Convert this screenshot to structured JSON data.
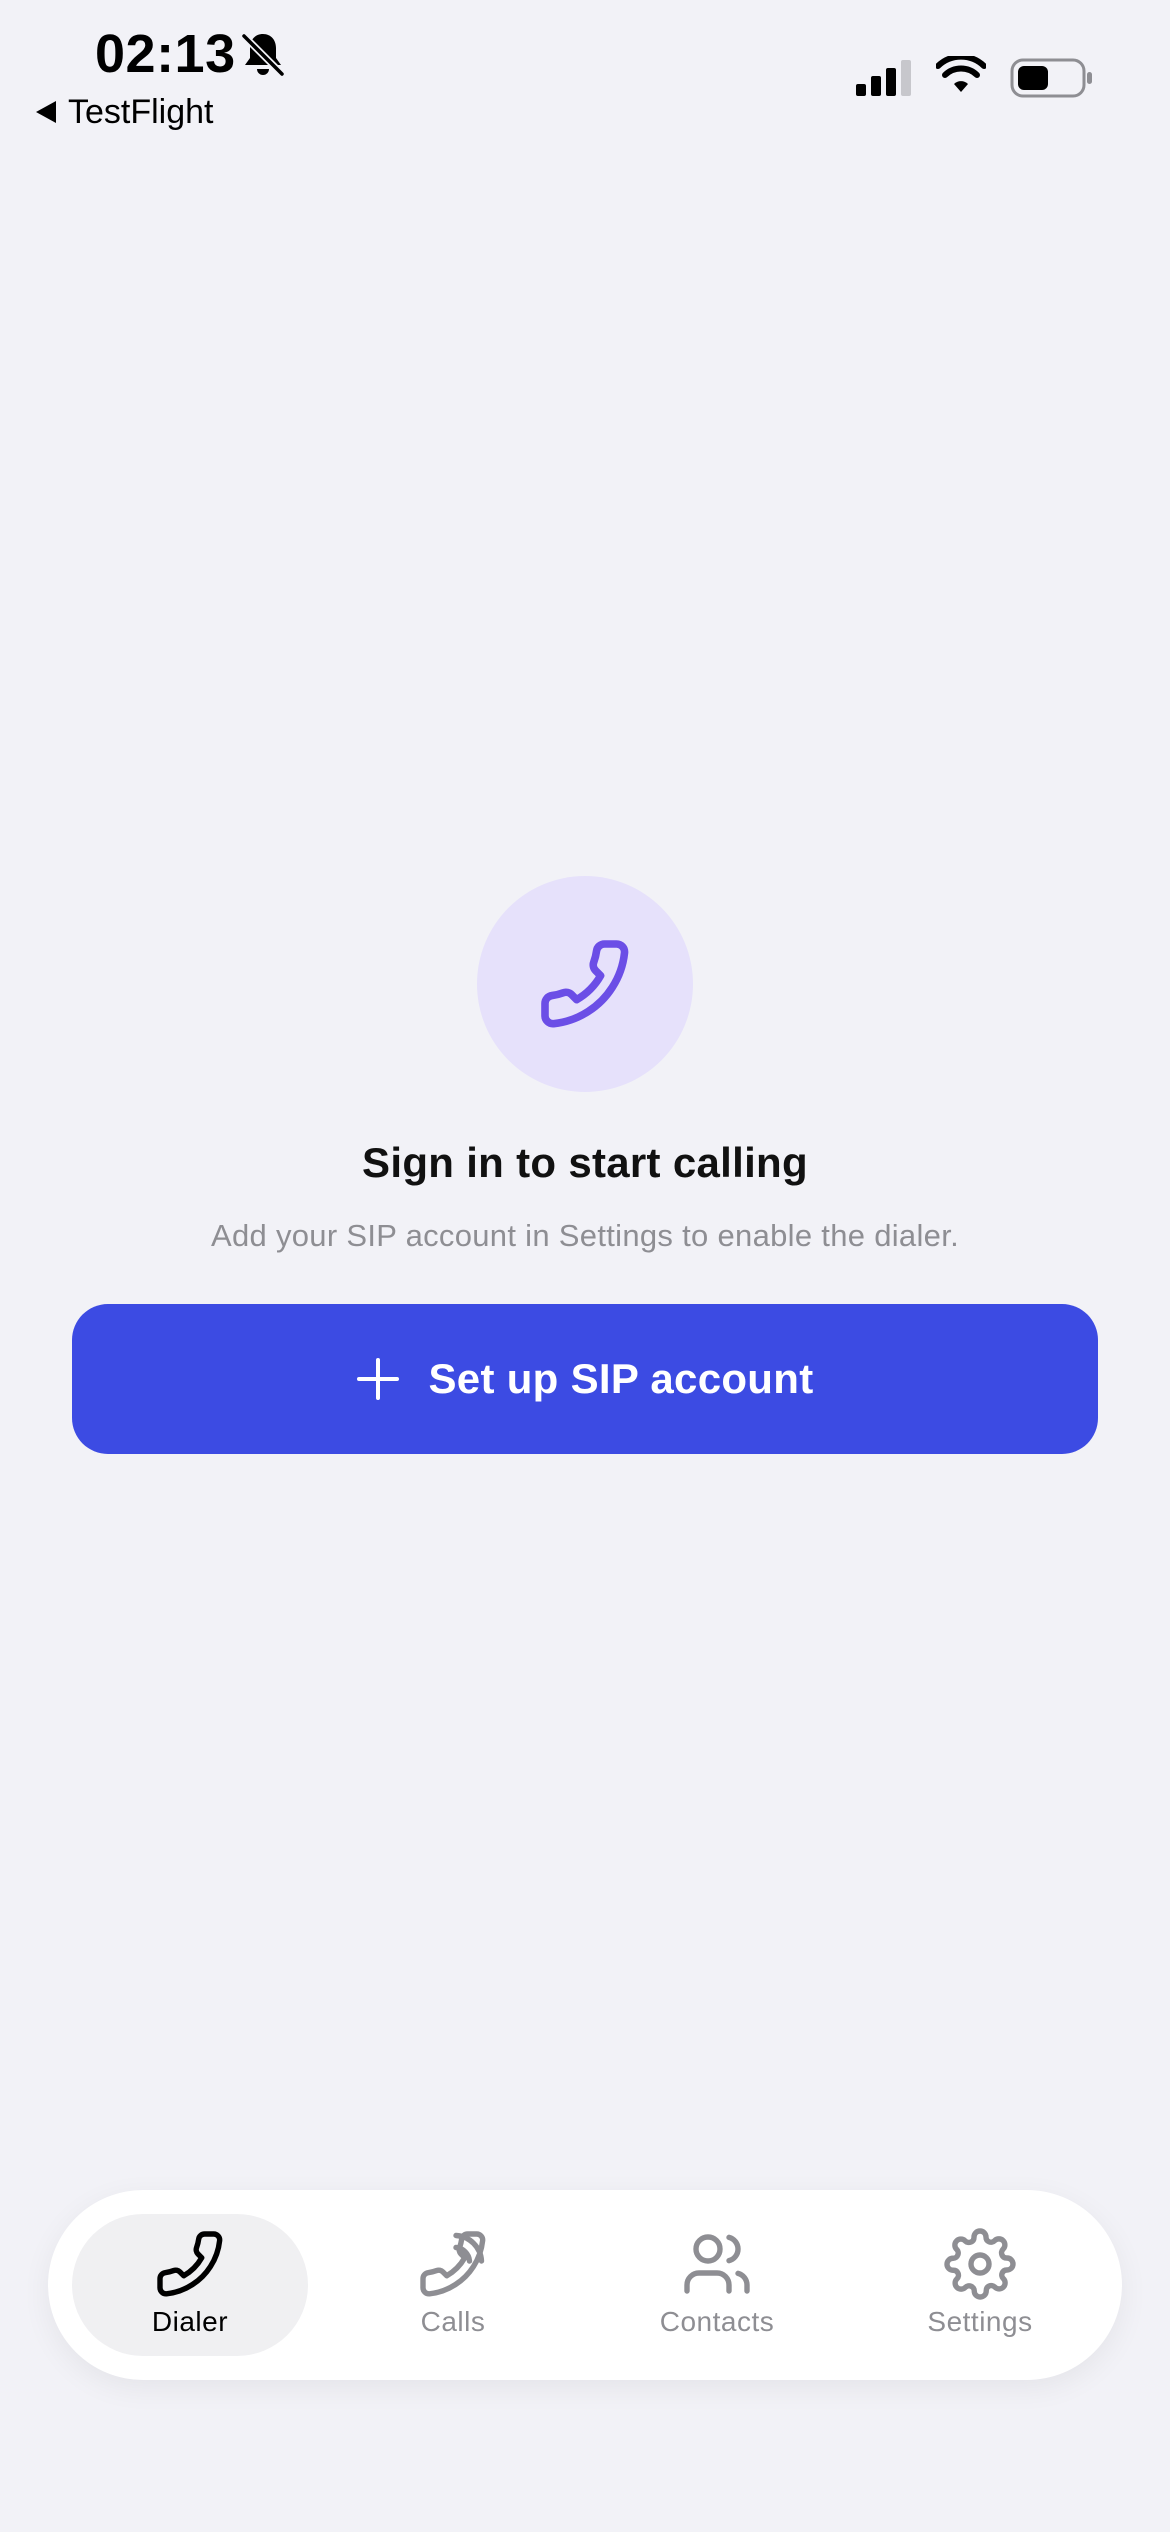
{
  "status_bar": {
    "time": "02:13",
    "back_label": "TestFlight",
    "icons": [
      "bell-slash-icon",
      "cellular-signal-icon",
      "wifi-icon",
      "battery-icon"
    ]
  },
  "empty_state": {
    "icon": "phone-icon",
    "title": "Sign in to start calling",
    "subtitle": "Add your SIP account in Settings to enable the dialer."
  },
  "setup_button": {
    "icon": "plus-icon",
    "label": "Set up SIP account"
  },
  "tab_bar": {
    "tabs": [
      {
        "label": "Dialer",
        "icon": "phone-icon",
        "active": true
      },
      {
        "label": "Calls",
        "icon": "phone-outgoing-icon",
        "active": false
      },
      {
        "label": "Contacts",
        "icon": "users-icon",
        "active": false
      },
      {
        "label": "Settings",
        "icon": "gear-icon",
        "active": false
      }
    ]
  },
  "colors": {
    "background": "#F2F2F7",
    "accent": "#3C4BE3",
    "icon_purple": "#6B4EE6",
    "icon_circle": "#E6E1FB",
    "muted_text": "#8E8E93"
  }
}
